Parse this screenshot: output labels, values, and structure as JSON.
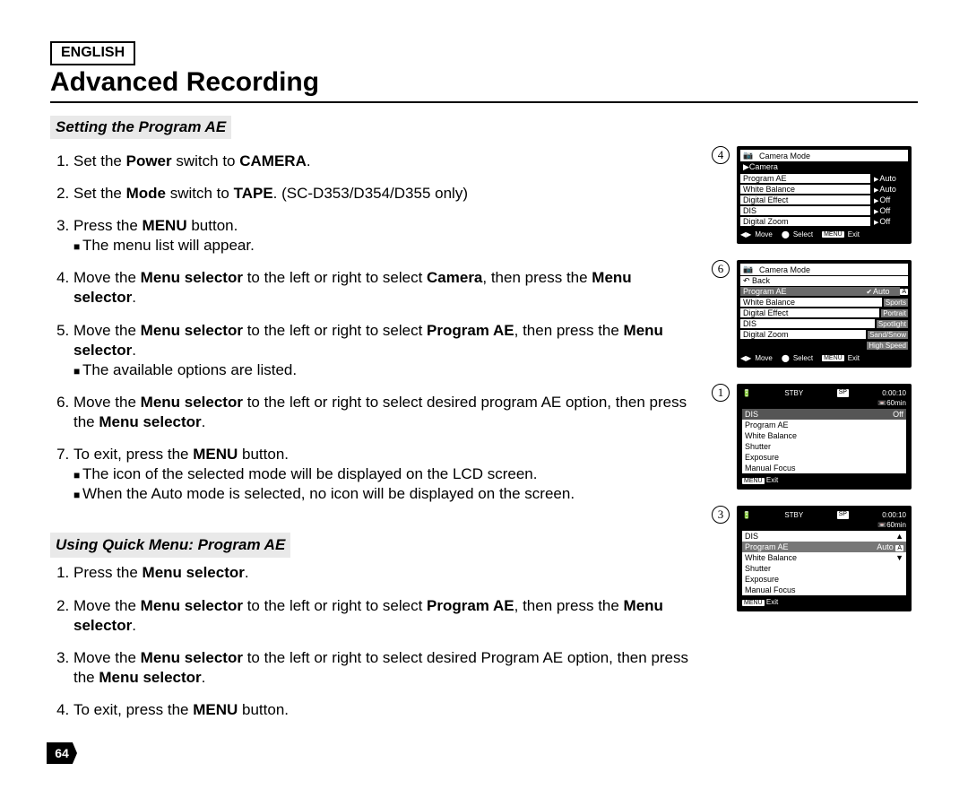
{
  "language": "ENGLISH",
  "title": "Advanced Recording",
  "section1": {
    "heading": "Setting the Program AE",
    "steps": [
      {
        "pre": "Set the ",
        "b1": "Power",
        "mid": " switch to ",
        "b2": "CAMERA",
        "post": "."
      },
      {
        "pre": "Set the ",
        "b1": "Mode",
        "mid": " switch to ",
        "b2": "TAPE",
        "post": ". (SC-D353/D354/D355 only)"
      },
      {
        "pre": "Press the ",
        "b1": "MENU",
        "mid": " button.",
        "sub": "The menu list will appear."
      },
      {
        "pre": "Move the ",
        "b1": "Menu selector",
        "mid": " to the left or right to select ",
        "b2": "Camera",
        "mid2": ", then press the ",
        "b3": "Menu selector",
        "post": "."
      },
      {
        "pre": "Move the ",
        "b1": "Menu selector",
        "mid": " to the left or right to select ",
        "b2": "Program AE",
        "mid2": ", then press the ",
        "b3": "Menu selector",
        "post": ".",
        "sub": "The available options are listed."
      },
      {
        "pre": "Move the ",
        "b1": "Menu selector",
        "mid": " to the left or right to select desired program AE option, then press the ",
        "b2": "Menu selector",
        "post": "."
      },
      {
        "pre": "To exit, press the ",
        "b1": "MENU",
        "mid": " button.",
        "sub": "The icon of the selected mode will be displayed on the LCD screen.",
        "sub2": "When the Auto mode is selected, no icon will be displayed on the screen."
      }
    ]
  },
  "section2": {
    "heading": "Using Quick Menu: Program AE",
    "steps": [
      {
        "pre": "Press the ",
        "b1": "Menu selector",
        "post": "."
      },
      {
        "pre": "Move the ",
        "b1": "Menu selector",
        "mid": " to the left or right to select ",
        "b2": "Program AE",
        "mid2": ", then press the ",
        "b3": "Menu selector",
        "post": "."
      },
      {
        "pre": "Move the ",
        "b1": "Menu selector",
        "mid": " to the left or right to select desired Program AE option, then press the ",
        "b2": "Menu selector",
        "post": "."
      },
      {
        "pre": "To exit, press the ",
        "b1": "MENU",
        "mid": " button."
      }
    ]
  },
  "screens": {
    "s4": {
      "step": "4",
      "mode": "Camera Mode",
      "camera": "▶Camera",
      "rows": [
        {
          "label": "Program AE",
          "val": "Auto",
          "arrow": true
        },
        {
          "label": "White Balance",
          "val": "Auto",
          "arrow": true
        },
        {
          "label": "Digital Effect",
          "val": "Off",
          "arrow": true
        },
        {
          "label": "DIS",
          "val": "Off",
          "arrow": true
        },
        {
          "label": "Digital Zoom",
          "val": "Off",
          "arrow": true
        }
      ],
      "footer": {
        "move": "Move",
        "select": "Select",
        "exit": "Exit",
        "menu": "MENU"
      }
    },
    "s6": {
      "step": "6",
      "mode": "Camera Mode",
      "back": "Back",
      "selected_row": {
        "label": "Program AE",
        "val": "Auto",
        "check": true,
        "badge": "A"
      },
      "rows": [
        {
          "label": "White Balance",
          "val": "Sports"
        },
        {
          "label": "Digital Effect",
          "val": "Portrait"
        },
        {
          "label": "DIS",
          "val": "Spotlight"
        },
        {
          "label": "Digital Zoom",
          "val": "Sand/Snow"
        },
        {
          "label": "",
          "val": "High Speed"
        }
      ],
      "footer": {
        "move": "Move",
        "select": "Select",
        "exit": "Exit",
        "menu": "MENU"
      }
    },
    "s1": {
      "step": "1",
      "status": "STBY",
      "sp": "SP",
      "time": "0:00:10",
      "remain": "60min",
      "dark": {
        "label": "DIS",
        "val": "Off"
      },
      "rows": [
        "Program AE",
        "White Balance",
        "Shutter",
        "Exposure",
        "Manual Focus"
      ],
      "exit": "Exit",
      "menu": "MENU"
    },
    "s3": {
      "step": "3",
      "status": "STBY",
      "sp": "SP",
      "time": "0:00:10",
      "remain": "60min",
      "dis": "DIS",
      "selected": {
        "label": "Program AE",
        "val": "Auto",
        "badge": "A"
      },
      "rows": [
        "White Balance",
        "Shutter",
        "Exposure",
        "Manual Focus"
      ],
      "exit": "Exit",
      "menu": "MENU"
    }
  },
  "page_number": "64"
}
